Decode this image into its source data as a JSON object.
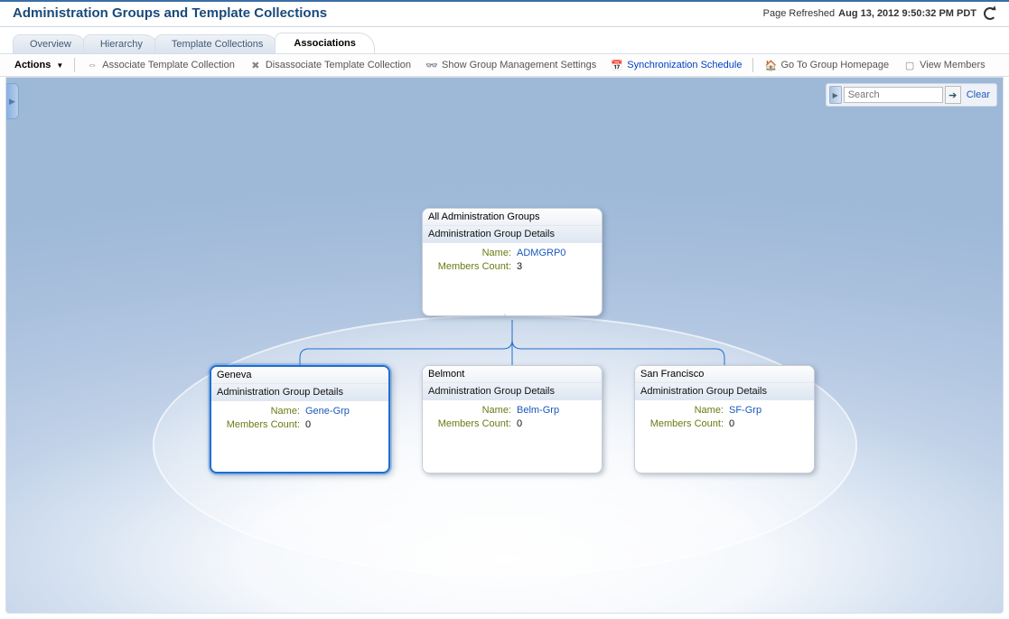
{
  "header": {
    "title": "Administration Groups and Template Collections",
    "refresh_prefix": "Page Refreshed",
    "refresh_timestamp": "Aug 13, 2012 9:50:32 PM PDT"
  },
  "tabs": {
    "items": [
      {
        "label": "Overview"
      },
      {
        "label": "Hierarchy"
      },
      {
        "label": "Template Collections"
      },
      {
        "label": "Associations"
      }
    ],
    "active_index": 3
  },
  "toolbar": {
    "actions_label": "Actions",
    "associate_label": "Associate Template Collection",
    "disassociate_label": "Disassociate Template Collection",
    "show_settings_label": "Show Group Management Settings",
    "sync_schedule_label": "Synchronization Schedule",
    "goto_homepage_label": "Go To Group Homepage",
    "view_members_label": "View Members"
  },
  "search": {
    "placeholder": "Search",
    "clear_label": "Clear"
  },
  "node_labels": {
    "subtitle": "Administration Group Details",
    "name_field": "Name:",
    "members_field": "Members Count:"
  },
  "hierarchy": {
    "root": {
      "title": "All Administration Groups",
      "name": "ADMGRP0",
      "members_count": "3"
    },
    "children": [
      {
        "title": "Geneva",
        "name": "Gene-Grp",
        "members_count": "0",
        "selected": true
      },
      {
        "title": "Belmont",
        "name": "Belm-Grp",
        "members_count": "0",
        "selected": false
      },
      {
        "title": "San Francisco",
        "name": "SF-Grp",
        "members_count": "0",
        "selected": false
      }
    ]
  }
}
